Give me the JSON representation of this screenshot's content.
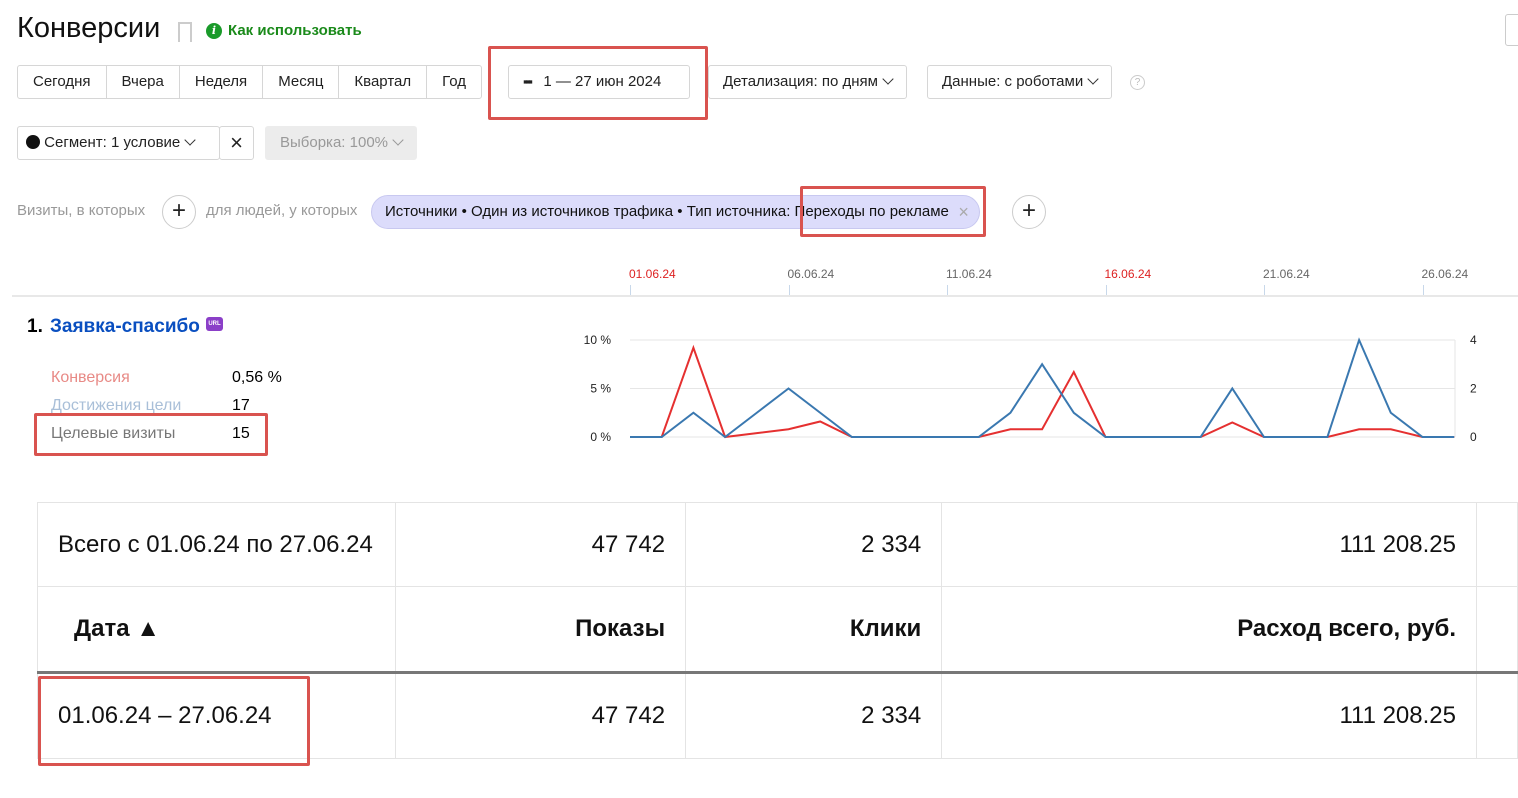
{
  "header": {
    "title": "Конверсии",
    "how_to": "Как использовать"
  },
  "period_buttons": [
    "Сегодня",
    "Вчера",
    "Неделя",
    "Месяц",
    "Квартал",
    "Год"
  ],
  "date_range": "1 — 27 июн 2024",
  "detail": "Детализация: по дням",
  "data_mode": "Данные: с роботами",
  "segment": "Сегмент: 1 условие",
  "sample": "Выборка: 100%",
  "filter": {
    "visits_label": "Визиты, в которых",
    "people_label": "для людей, у которых",
    "chip": "Источники • Один из источников трафика • Тип источника: Переходы по рекламе"
  },
  "goal": {
    "number": "1.",
    "name": "Заявка-спасибо",
    "badge": "URL",
    "metrics": [
      {
        "label": "Конверсия",
        "value": "0,56 %",
        "color": "#e88a86"
      },
      {
        "label": "Достижения цели",
        "value": "17",
        "color": "#a9bfd8"
      },
      {
        "label": "Целевые визиты",
        "value": "15",
        "color": "#777777"
      }
    ]
  },
  "chart_data": {
    "type": "line",
    "x_ticks": [
      {
        "label": "01.06.24",
        "day": 1,
        "weekend": true
      },
      {
        "label": "06.06.24",
        "day": 6,
        "weekend": false
      },
      {
        "label": "11.06.24",
        "day": 11,
        "weekend": false
      },
      {
        "label": "16.06.24",
        "day": 16,
        "weekend": true
      },
      {
        "label": "21.06.24",
        "day": 21,
        "weekend": false
      },
      {
        "label": "26.06.24",
        "day": 26,
        "weekend": false
      }
    ],
    "x": [
      1,
      2,
      3,
      4,
      5,
      6,
      7,
      8,
      9,
      10,
      11,
      12,
      13,
      14,
      15,
      16,
      17,
      18,
      19,
      20,
      21,
      22,
      23,
      24,
      25,
      26,
      27
    ],
    "left_axis": {
      "ticks": [
        "0 %",
        "5 %",
        "10 %"
      ],
      "ylim": [
        0,
        10
      ]
    },
    "right_axis": {
      "ticks": [
        "0",
        "2",
        "4"
      ],
      "ylim": [
        0,
        4
      ]
    },
    "series": [
      {
        "axis": "left",
        "color": "#e53030",
        "values": [
          0,
          0,
          9.2,
          0,
          0.4,
          0.8,
          1.6,
          0,
          0,
          0,
          0,
          0,
          0.8,
          0.8,
          6.7,
          0,
          0,
          0,
          0,
          1.5,
          0,
          0,
          0,
          0.8,
          0.8,
          0,
          0
        ]
      },
      {
        "axis": "right",
        "color": "#3a78b0",
        "values": [
          0,
          0,
          1,
          0,
          1,
          2,
          1,
          0,
          0,
          0,
          0,
          0,
          1,
          3,
          1,
          0,
          0,
          0,
          0,
          2,
          0,
          0,
          0,
          4,
          1,
          0,
          0
        ]
      }
    ]
  },
  "table": {
    "total_label": "Всего с 01.06.24 по 27.06.24",
    "totals": [
      "47 742",
      "2 334",
      "111 208.25"
    ],
    "headers": [
      "Дата ▲",
      "Показы",
      "Клики",
      "Расход всего, руб."
    ],
    "rows": [
      [
        "01.06.24 – 27.06.24",
        "47 742",
        "2 334",
        "111 208.25"
      ]
    ]
  }
}
